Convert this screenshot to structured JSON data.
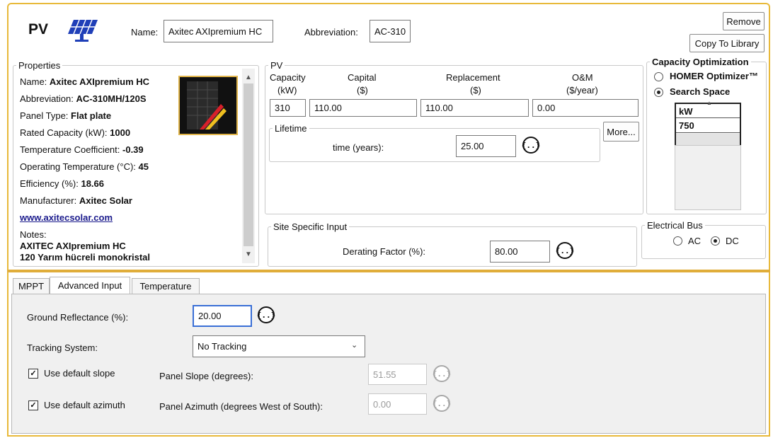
{
  "header": {
    "title": "PV",
    "name_label": "Name:",
    "name_value": "Axitec AXIpremium HC",
    "abbr_label": "Abbreviation:",
    "abbr_value": "AC-310",
    "remove_label": "Remove",
    "copy_label": "Copy To Library"
  },
  "properties": {
    "legend": "Properties",
    "rows": [
      {
        "label": "Name:",
        "value": "Axitec AXIpremium HC"
      },
      {
        "label": "Abbreviation:",
        "value": "AC-310MH/120S"
      },
      {
        "label": "Panel Type:",
        "value": "Flat plate"
      },
      {
        "label": "Rated Capacity (kW):",
        "value": "1000"
      },
      {
        "label": "Temperature Coefficient:",
        "value": "-0.39"
      },
      {
        "label": "Operating Temperature (°C):",
        "value": "45"
      },
      {
        "label": "Efficiency (%):",
        "value": "18.66"
      },
      {
        "label": "Manufacturer:",
        "value": "Axitec Solar"
      }
    ],
    "link": "www.axitecsolar.com",
    "notes_label": "Notes:",
    "notes_line1": "AXITEC AXIpremium HC",
    "notes_line2": "120 Yarım hücreli monokristal"
  },
  "pv": {
    "legend": "PV",
    "capacity_label": "Capacity",
    "capacity_unit": "(kW)",
    "capital_label": "Capital",
    "capital_unit": "($)",
    "replacement_label": "Replacement",
    "replacement_unit": "($)",
    "om_label": "O&M",
    "om_unit": "($/year)",
    "capacity_value": "310",
    "capital_value": "110.00",
    "replacement_value": "110.00",
    "om_value": "0.00",
    "lifetime_legend": "Lifetime",
    "time_label": "time (years):",
    "time_value": "25.00",
    "more_label": "More..."
  },
  "site": {
    "legend": "Site Specific Input",
    "derating_label": "Derating Factor (%):",
    "derating_value": "80.00"
  },
  "capacity_opt": {
    "legend": "Capacity Optimization",
    "homer_label": "HOMER Optimizer™",
    "search_label": "Search Space",
    "selected": "Search Space",
    "grid_header": "kW",
    "grid_value": "750"
  },
  "bus": {
    "legend": "Electrical Bus",
    "ac_label": "AC",
    "dc_label": "DC",
    "selected": "DC"
  },
  "tabs": [
    {
      "label": "MPPT"
    },
    {
      "label": "Advanced Input"
    },
    {
      "label": "Temperature"
    }
  ],
  "active_tab": "Advanced Input",
  "advanced": {
    "reflectance_label": "Ground Reflectance (%):",
    "reflectance_value": "20.00",
    "tracking_label": "Tracking System:",
    "tracking_value": "No Tracking",
    "default_slope_label": "Use default slope",
    "default_slope_checked": true,
    "slope_label": "Panel Slope (degrees):",
    "slope_value": "51.55",
    "default_azimuth_label": "Use default azimuth",
    "default_azimuth_checked": true,
    "azimuth_label": "Panel Azimuth (degrees West of South):",
    "azimuth_value": "0.00"
  },
  "icons": {
    "formula": "sensitivity-formula-icon",
    "pv": "solar-panel-icon",
    "thumbnail": "panel-thumbnail"
  },
  "colors": {
    "frame": "#e8b93a",
    "focus": "#3a6fd6",
    "link": "#1a1a8c"
  }
}
